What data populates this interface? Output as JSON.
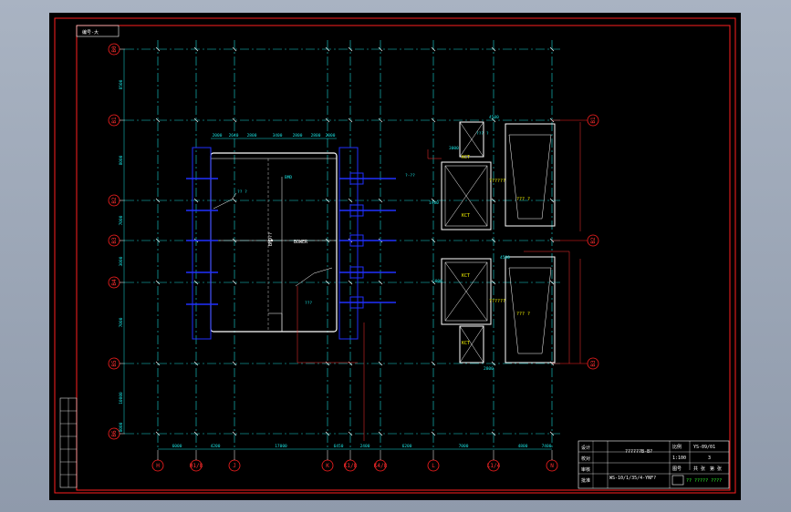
{
  "drawing": {
    "corner_tag": "编号-大",
    "center_label": "BOWER",
    "title_block": {
      "title": "??????B-B?",
      "drawing_no": "YS-09/01",
      "sheet_no": "3",
      "spec": "WS-10/1/35/4-YNF?",
      "company": "?? ????? ????",
      "row_labels": [
        "设计",
        "校对",
        "审核",
        "批准"
      ],
      "extra_cells": [
        "比例",
        "1:100",
        "图号",
        "共 张",
        "第 张"
      ]
    },
    "row_axes": [
      "B0",
      "B1",
      "B2",
      "B3",
      "B4",
      "B5",
      "B6"
    ],
    "right_axes": [
      "B1",
      "B2",
      "B3"
    ],
    "col_axes": [
      "H",
      "H1/8",
      "J",
      "K",
      "K1/8",
      "K4/8",
      "L",
      "L1/4",
      "N"
    ],
    "bottom_dims": [
      "6000",
      "4200",
      "17000",
      "6450",
      "2400",
      "6200",
      "7000",
      "4800",
      "7400"
    ],
    "left_dims": [
      "8500",
      "8000",
      "7000",
      "3000",
      "7000",
      "10000",
      "8000"
    ],
    "top_dims": [
      "2000",
      "2640",
      "2800",
      "3400",
      "2800",
      "2800",
      "2000"
    ],
    "tank_labels": [
      "KCT",
      "KCT",
      "KCT",
      "KCT",
      "??????",
      "??????",
      "??? ?",
      "??? ?"
    ],
    "misc_labels": [
      "BMD",
      "?? ?",
      "???",
      "?-??",
      "3000",
      "??? ?",
      "4500",
      "4500",
      "1900",
      "5000",
      "2800"
    ],
    "colors": {
      "background": "#000000",
      "border": "#ff2020",
      "grid": "#18d6d6",
      "equipment": "#ffffff",
      "pipe": "#2030ff",
      "dims": "#19e0e0",
      "axis_marker": "#ff2020"
    }
  }
}
